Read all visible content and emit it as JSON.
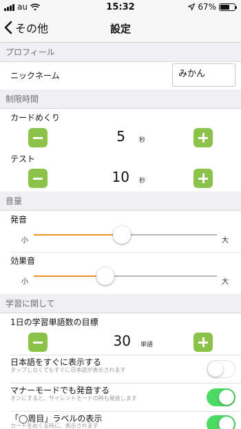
{
  "status_bar": {
    "carrier": "au",
    "time": "15:32",
    "battery_percent": "67%",
    "battery_level": 0.67,
    "icons": [
      "signal-icon",
      "wifi-icon",
      "location-arrow-icon",
      "battery-icon"
    ]
  },
  "nav": {
    "back_label": "その他",
    "title": "設定"
  },
  "sections": {
    "profile": "プロフィール",
    "time_limit": "制限時間",
    "volume": "音量",
    "learning": "学習に関して"
  },
  "profile": {
    "nickname_label": "ニックネーム",
    "nickname_value": "みかん"
  },
  "time_limit": {
    "card_flip": {
      "label": "カードめくり",
      "value": "5",
      "unit": "秒"
    },
    "test": {
      "label": "テスト",
      "value": "10",
      "unit": "秒"
    }
  },
  "volume": {
    "pronunciation": {
      "label": "発音",
      "min_label": "小",
      "max_label": "大",
      "level": 0.48
    },
    "sound_effect": {
      "label": "効果音",
      "min_label": "小",
      "max_label": "大",
      "level": 0.39
    }
  },
  "learning": {
    "daily_goal": {
      "label": "1日の学習単語数の目標",
      "value": "30",
      "unit": "単語"
    },
    "show_japanese": {
      "label": "日本語をすぐに表示する",
      "sub": "タップしなくてもすぐに日本語が表示されます",
      "on": false
    },
    "manner_mode": {
      "label": "マナーモードでも発音する",
      "sub": "オンにすると、サイレントモードの時も発音します",
      "on": true
    },
    "lap_label": {
      "label": "「◯周目」ラベルの表示",
      "sub": "カードをめくる時に、表示されます",
      "on": true
    }
  },
  "colors": {
    "step_button": "#8bc34a",
    "slider_fill": "#f0932b",
    "toggle_on": "#4cd964",
    "section_bg": "#efeff4"
  }
}
